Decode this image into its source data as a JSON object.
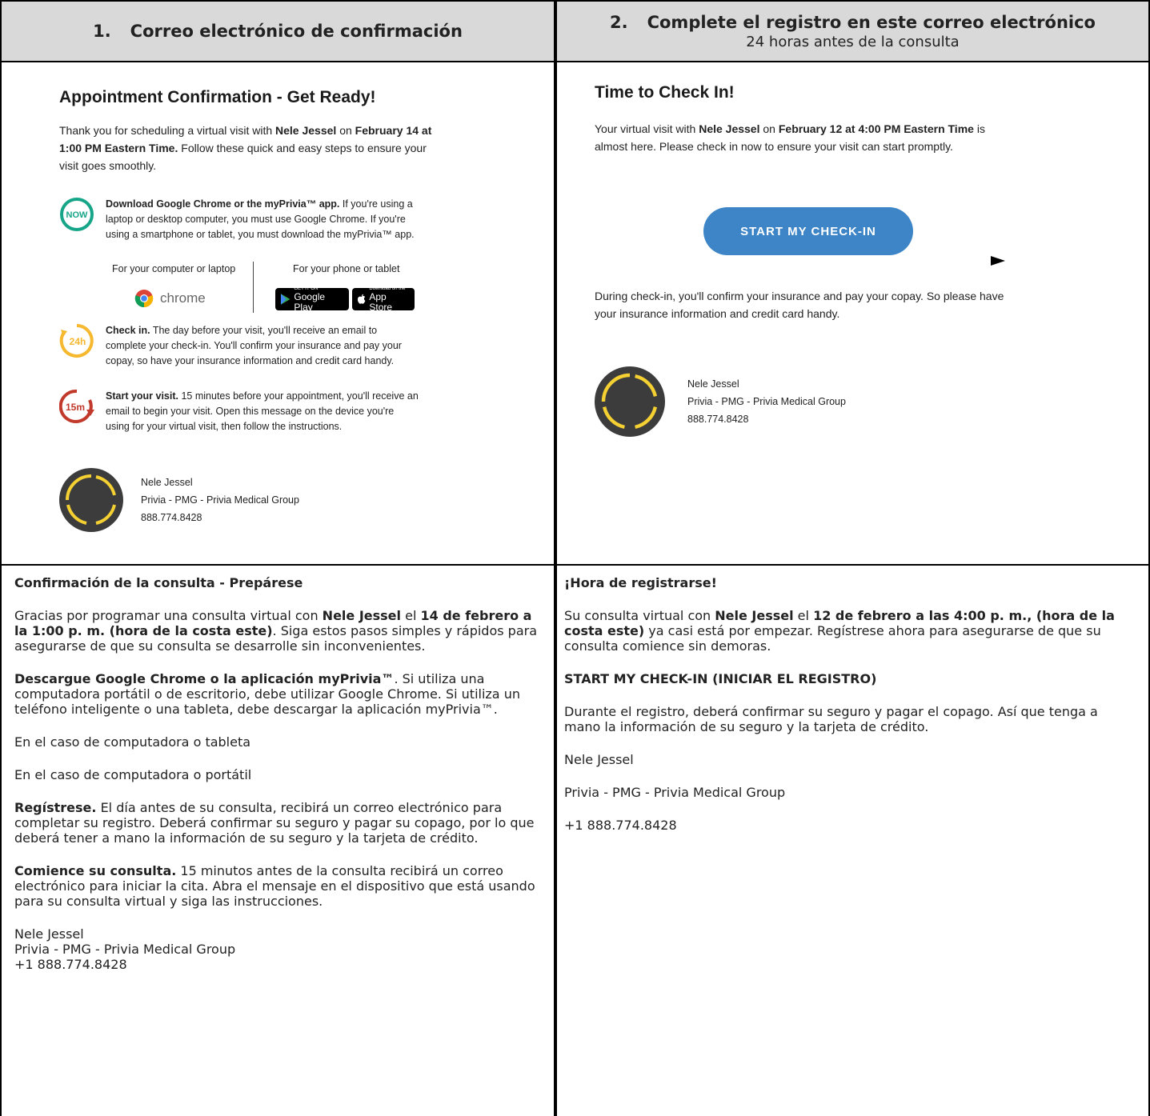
{
  "headers": {
    "col1": {
      "number": "1.",
      "title": "Correo electrónico de confirmación"
    },
    "col2": {
      "number": "2.",
      "title": "Complete el registro en este correo electrónico",
      "subtitle": "24 horas antes de la consulta"
    }
  },
  "email1": {
    "title": "Appointment Confirmation - Get Ready!",
    "intro": {
      "a": "Thank you for scheduling a virtual visit with ",
      "provider": "Nele Jessel",
      "b": " on ",
      "datetime": "February 14 at 1:00 PM Eastern Time.",
      "c": " Follow these quick and easy steps to ensure your visit goes smoothly."
    },
    "step_now": {
      "icon_label": "NOW",
      "bold": "Download Google Chrome or the myPrivia™ app.",
      "text": " If you're using a laptop or desktop computer, you must use Google Chrome. If you're using a smartphone or tablet, you must download the myPrivia™ app."
    },
    "stores": {
      "computer_label": "For your computer or laptop",
      "phone_label": "For your phone or tablet",
      "chrome_text": "chrome",
      "google_play_small": "GET IT ON",
      "google_play_big": "Google Play",
      "app_store_small": "Download on the",
      "app_store_big": "App Store"
    },
    "step_24h": {
      "icon_label": "24h",
      "bold": "Check in.",
      "text": " The day before your visit, you'll receive an email to complete your check-in. You'll confirm your insurance and pay your copay, so have your insurance information and credit card handy."
    },
    "step_15m": {
      "icon_label": "15m",
      "bold": "Start your visit.",
      "text": " 15 minutes before your appointment, you'll receive an email to begin your visit. Open this message on the device you're using for your virtual visit, then follow the instructions."
    },
    "signature": {
      "name": "Nele Jessel",
      "org": "Privia - PMG - Privia Medical Group",
      "phone": "888.774.8428"
    }
  },
  "email2": {
    "title": "Time to Check In!",
    "intro": {
      "a": "Your virtual visit with ",
      "provider": "Nele Jessel",
      "b": " on ",
      "datetime": "February 12 at 4:00 PM Eastern Time",
      "c": " is almost here. Please check in now to ensure your visit can start promptly."
    },
    "button": "START MY CHECK-IN",
    "note": "During check-in, you'll confirm your insurance and pay your copay. So please have your insurance information and credit card handy.",
    "signature": {
      "name": "Nele Jessel",
      "org": "Privia - PMG - Privia Medical Group",
      "phone": "888.774.8428"
    }
  },
  "trans1": {
    "title": "Confirmación de la consulta - Prepárese",
    "p1": {
      "a": "Gracias por programar una consulta virtual con ",
      "provider": "Nele Jessel",
      "b": " el ",
      "datetime": "14 de febrero a la 1:00 p. m. (hora de la costa este)",
      "c": ". Siga estos pasos simples y rápidos para asegurarse de que su consulta se desarrolle sin inconvenientes."
    },
    "p2": {
      "bold": "Descargue Google Chrome o la aplicación myPrivia™",
      "text": ". Si utiliza una computadora portátil o de escritorio, debe utilizar Google Chrome. Si utiliza un teléfono inteligente o una tableta, debe descargar la aplicación myPrivia™."
    },
    "p3": "En el caso de computadora o tableta",
    "p4": "En el caso de computadora o portátil",
    "p5": {
      "bold": "Regístrese.",
      "text": " El día antes de su consulta, recibirá un correo electrónico para completar su registro. Deberá confirmar su seguro y pagar su copago, por lo que deberá tener a mano la información de su seguro y la tarjeta de crédito."
    },
    "p6": {
      "bold": "Comience su consulta.",
      "text": " 15 minutos antes de la consulta recibirá un correo electrónico para iniciar la cita. Abra el mensaje en el dispositivo que está usando para su consulta virtual y siga las instrucciones."
    },
    "signature": {
      "name": "Nele Jessel",
      "org": "Privia - PMG - Privia Medical Group",
      "phone": "+1 888.774.8428"
    }
  },
  "trans2": {
    "title": "¡Hora de registrarse!",
    "p1": {
      "a": "Su consulta virtual con ",
      "provider": "Nele Jessel",
      "b": " el ",
      "datetime": "12 de febrero a las 4:00 p. m., (hora de la costa este)",
      "c": " ya casi está por empezar. Regístrese ahora para asegurarse de que su consulta comience sin demoras."
    },
    "button": "START MY CHECK-IN (INICIAR EL REGISTRO)",
    "p2": "Durante el registro, deberá confirmar su seguro y pagar el copago. Así que tenga a mano la información de su seguro y la tarjeta de crédito.",
    "name": "Nele Jessel",
    "org": "Privia - PMG - Privia Medical Group",
    "phone": "+1 888.774.8428"
  },
  "colors": {
    "header_bg": "#d9d9d9",
    "button_blue": "#3d85c6",
    "now_teal": "#17a589",
    "h24_yellow": "#f5b82e",
    "m15_red": "#c0392b"
  }
}
